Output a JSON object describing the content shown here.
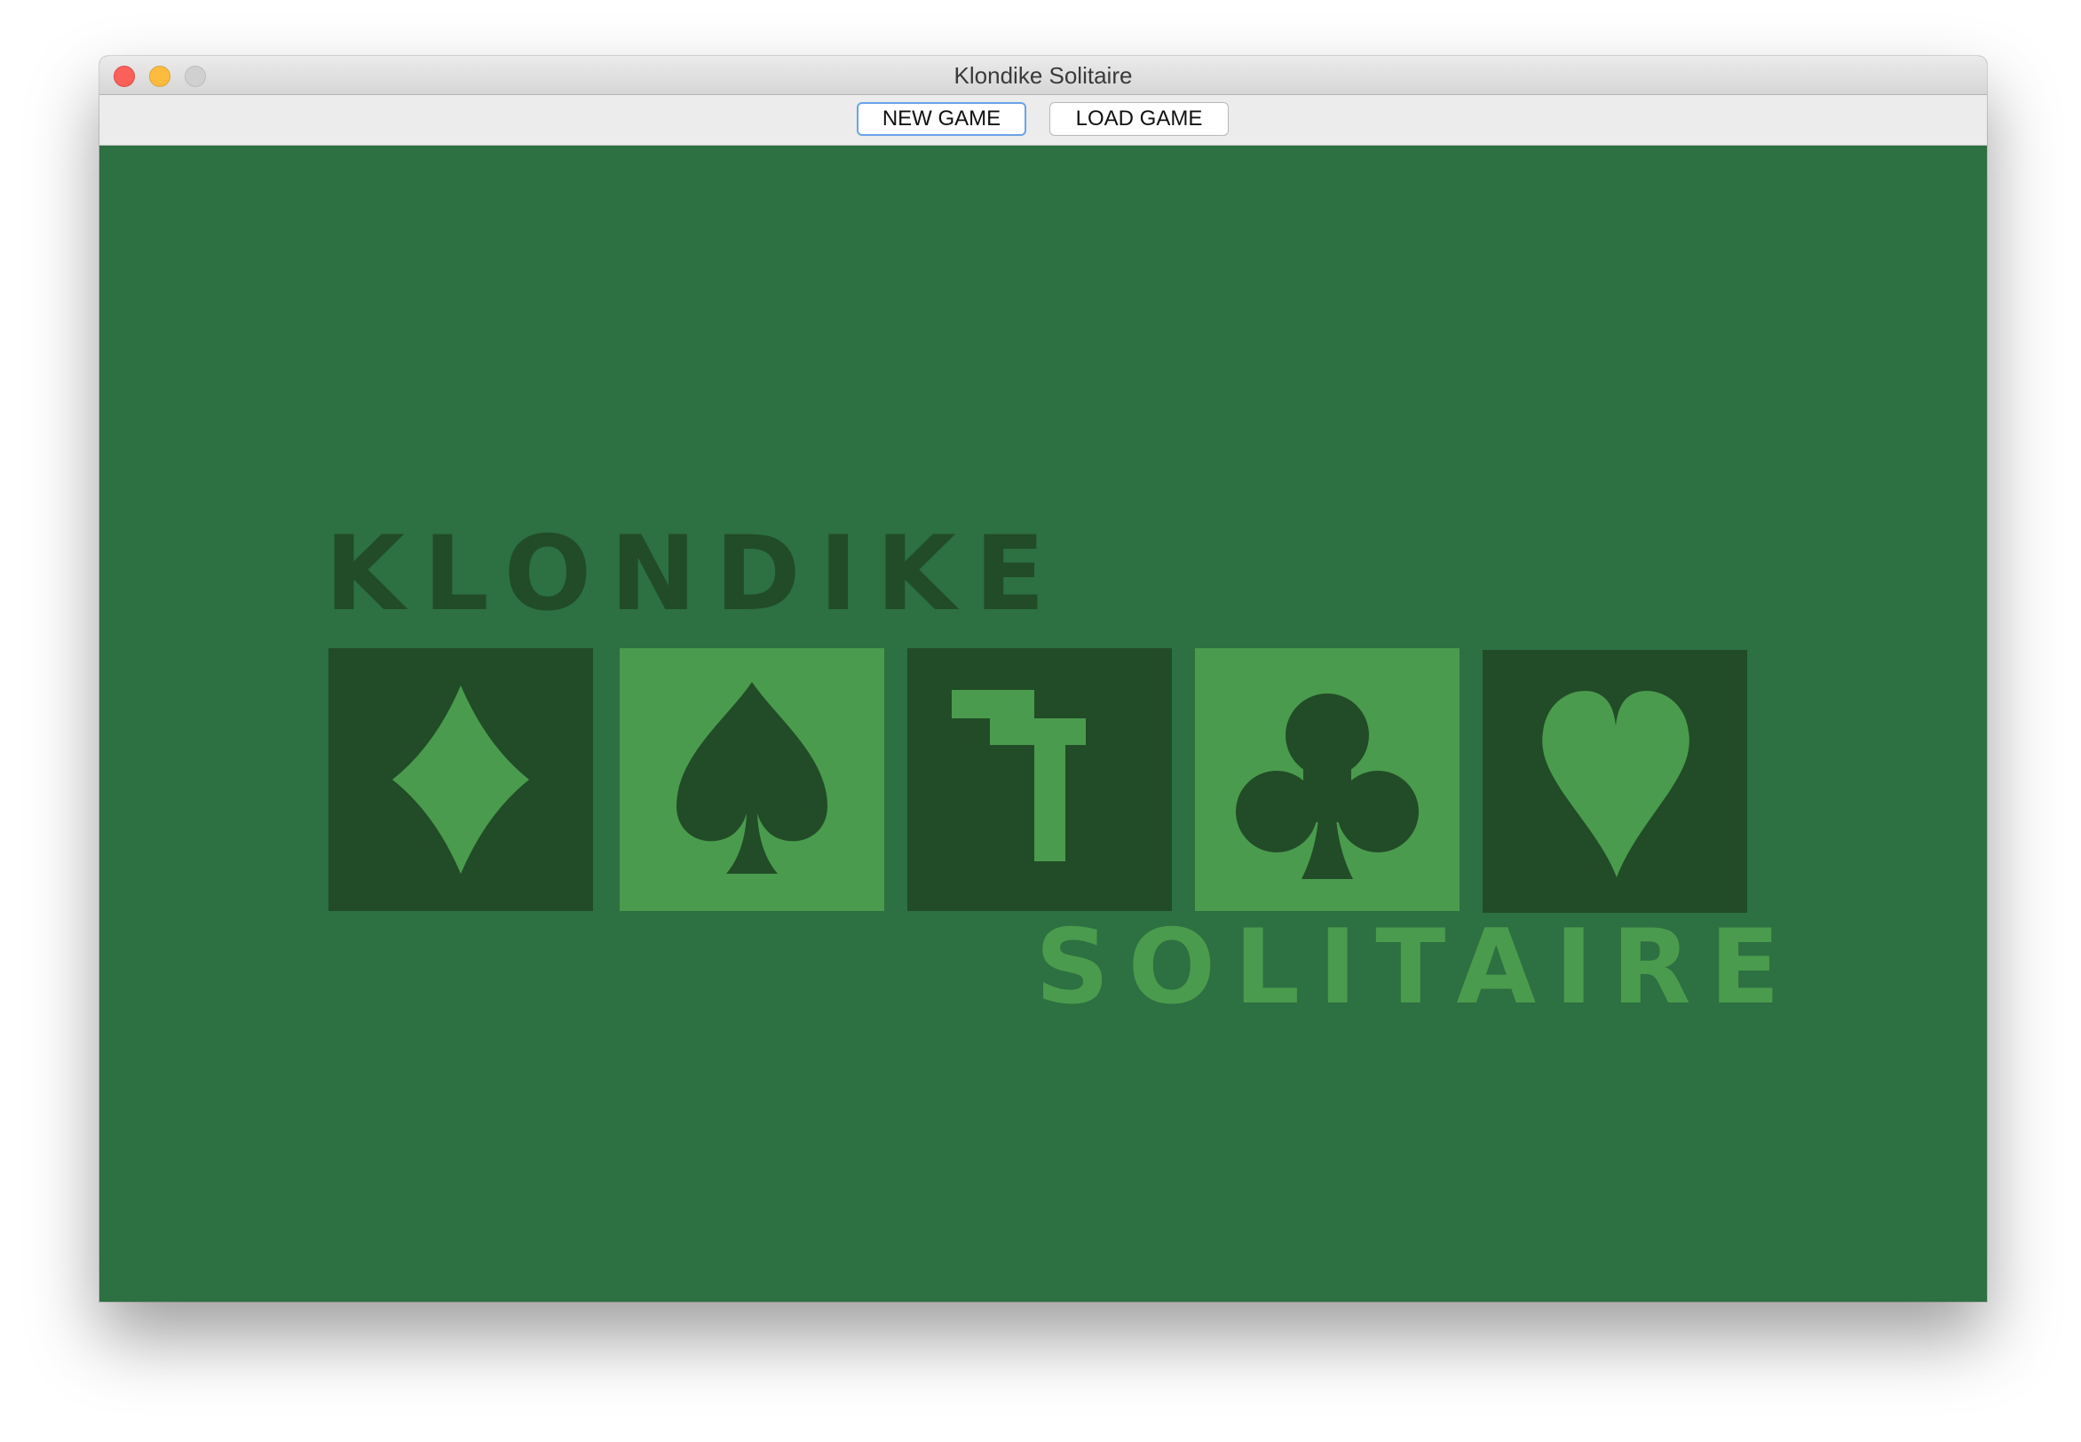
{
  "window": {
    "title": "Klondike Solitaire"
  },
  "toolbar": {
    "new_game_label": "NEW GAME",
    "load_game_label": "LOAD GAME"
  },
  "logo": {
    "top_word": "KLONDIKE",
    "bottom_word": "SOLITAIRE",
    "tiles": [
      {
        "icon": "diamond-icon",
        "style": "dark"
      },
      {
        "icon": "spade-icon",
        "style": "light"
      },
      {
        "icon": "t-mark-icon",
        "style": "dark"
      },
      {
        "icon": "club-icon",
        "style": "light"
      },
      {
        "icon": "heart-icon",
        "style": "dark"
      }
    ]
  },
  "colors": {
    "felt": "#2d7041",
    "logo_dark": "#214c27",
    "logo_light": "#4b9b4e",
    "focus_ring": "#6aa2e8"
  }
}
